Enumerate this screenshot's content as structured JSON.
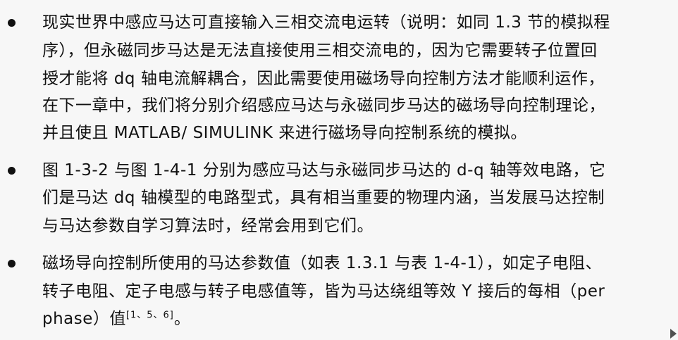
{
  "bullets": [
    {
      "lines": [
        "现实世界中感应马达可直接输入三相交流电运转（说明：如同 1.3 节的模拟程",
        "序），但永磁同步马达是无法直接使用三相交流电的，因为它需要转子位置回",
        "授才能将 dq 轴电流解耦合，因此需要使用磁场导向控制方法才能顺利运作，",
        "在下一章中，我们将分别介绍感应马达与永磁同步马达的磁场导向控制理论，",
        "并且使且 MATLAB/ SIMULINK 来进行磁场导向控制系统的模拟。"
      ]
    },
    {
      "lines": [
        "图 1-3-2 与图 1-4-1 分别为感应马达与永磁同步马达的 d-q 轴等效电路，它",
        "们是马达 dq 轴模型的电路型式，具有相当重要的物理内涵，当发展马达控制",
        "与马达参数自学习算法时，经常会用到它们。"
      ]
    },
    {
      "lines": [
        "磁场导向控制所使用的马达参数值（如表 1.3.1 与表 1-4-1），如定子电阻、",
        "转子电阻、定子电感与转子电感值等，皆为马达绕组等效 Y 接后的每相（per",
        "phase）值"
      ],
      "citation": "[1、5、6]",
      "tail": "。"
    }
  ],
  "colors": {
    "text": "#111111",
    "background": "#f7f7f7"
  }
}
